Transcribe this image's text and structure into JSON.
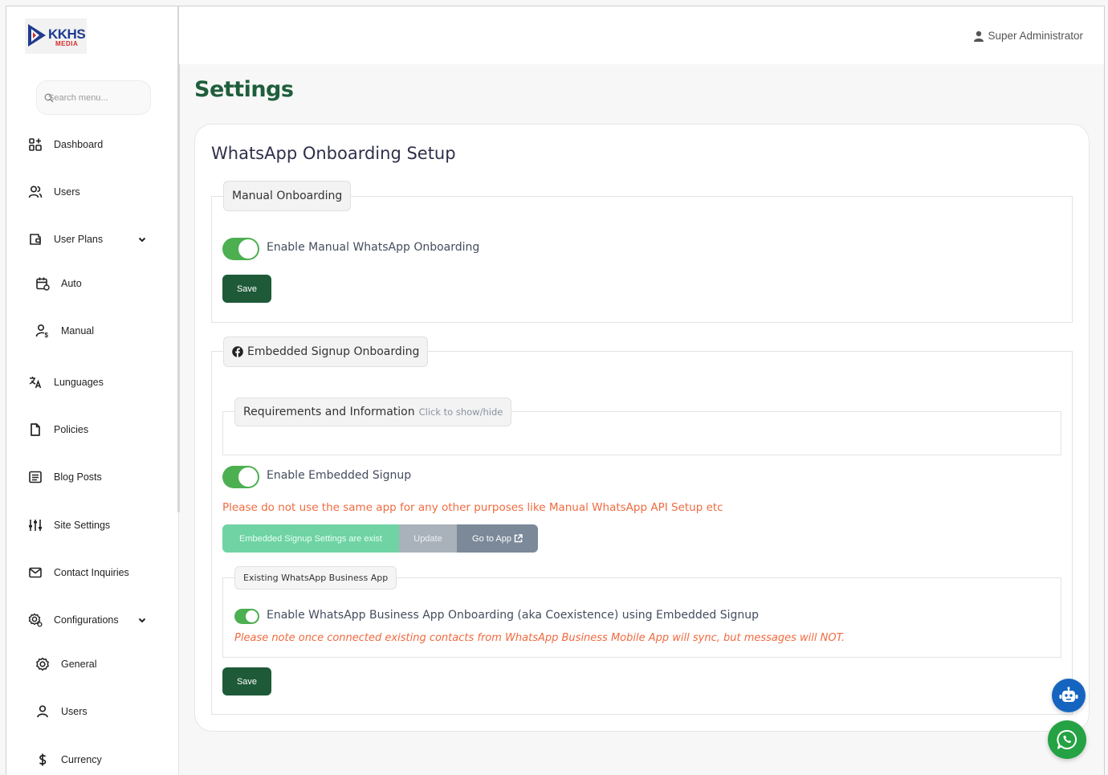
{
  "brand": {
    "logo_main": "KKHS",
    "logo_sub": "MEDIA"
  },
  "search": {
    "placeholder": "Search menu..."
  },
  "sidebar": {
    "items": [
      {
        "label": "Dashboard",
        "icon": "dashboard-icon"
      },
      {
        "label": "Users",
        "icon": "users-icon"
      },
      {
        "label": "User Plans",
        "icon": "wallet-icon"
      },
      {
        "label": "Auto",
        "icon": "calendar-repeat-icon"
      },
      {
        "label": "Manual",
        "icon": "user-dollar-icon"
      },
      {
        "label": "Lunguages",
        "icon": "translate-icon"
      },
      {
        "label": "Policies",
        "icon": "file-icon"
      },
      {
        "label": "Blog Posts",
        "icon": "article-icon"
      },
      {
        "label": "Site Settings",
        "icon": "sliders-icon"
      },
      {
        "label": "Contact Inquiries",
        "icon": "mail-icon"
      },
      {
        "label": "Configurations",
        "icon": "settings-cog-icon"
      },
      {
        "label": "General",
        "icon": "gear-icon"
      },
      {
        "label": "Users",
        "icon": "user-icon"
      },
      {
        "label": "Currency",
        "icon": "dollar-icon"
      }
    ]
  },
  "header": {
    "user_name": "Super Administrator"
  },
  "page": {
    "title": "Settings"
  },
  "card": {
    "title": "WhatsApp Onboarding Setup",
    "manual": {
      "legend": "Manual Onboarding",
      "toggle_label": "Enable Manual WhatsApp Onboarding",
      "toggle_on": true,
      "save_label": "Save"
    },
    "embedded": {
      "legend": "Embedded Signup Onboarding",
      "requirements_legend": "Requirements and Information",
      "requirements_hint": "Click to show/hide",
      "toggle_label": "Enable Embedded Signup",
      "toggle_on": true,
      "warning": "Please do not use the same app for any other purposes like Manual WhatsApp API Setup etc",
      "status_button": "Embedded Signup Settings are exist",
      "update_button": "Update",
      "goto_button": "Go to App",
      "existing": {
        "legend": "Existing WhatsApp Business App",
        "toggle_label": "Enable WhatsApp Business App Onboarding (aka Coexistence) using Embedded Signup",
        "toggle_on": true,
        "note": "Please note once connected existing contacts from WhatsApp Business Mobile App will sync, but messages will NOT."
      },
      "save_label": "Save"
    }
  },
  "colors": {
    "primary": "#1e5a38",
    "toggle": "#4caf50",
    "warning": "#f06a3f",
    "bot_fab": "#1565c0",
    "whatsapp_fab": "#25a244"
  }
}
